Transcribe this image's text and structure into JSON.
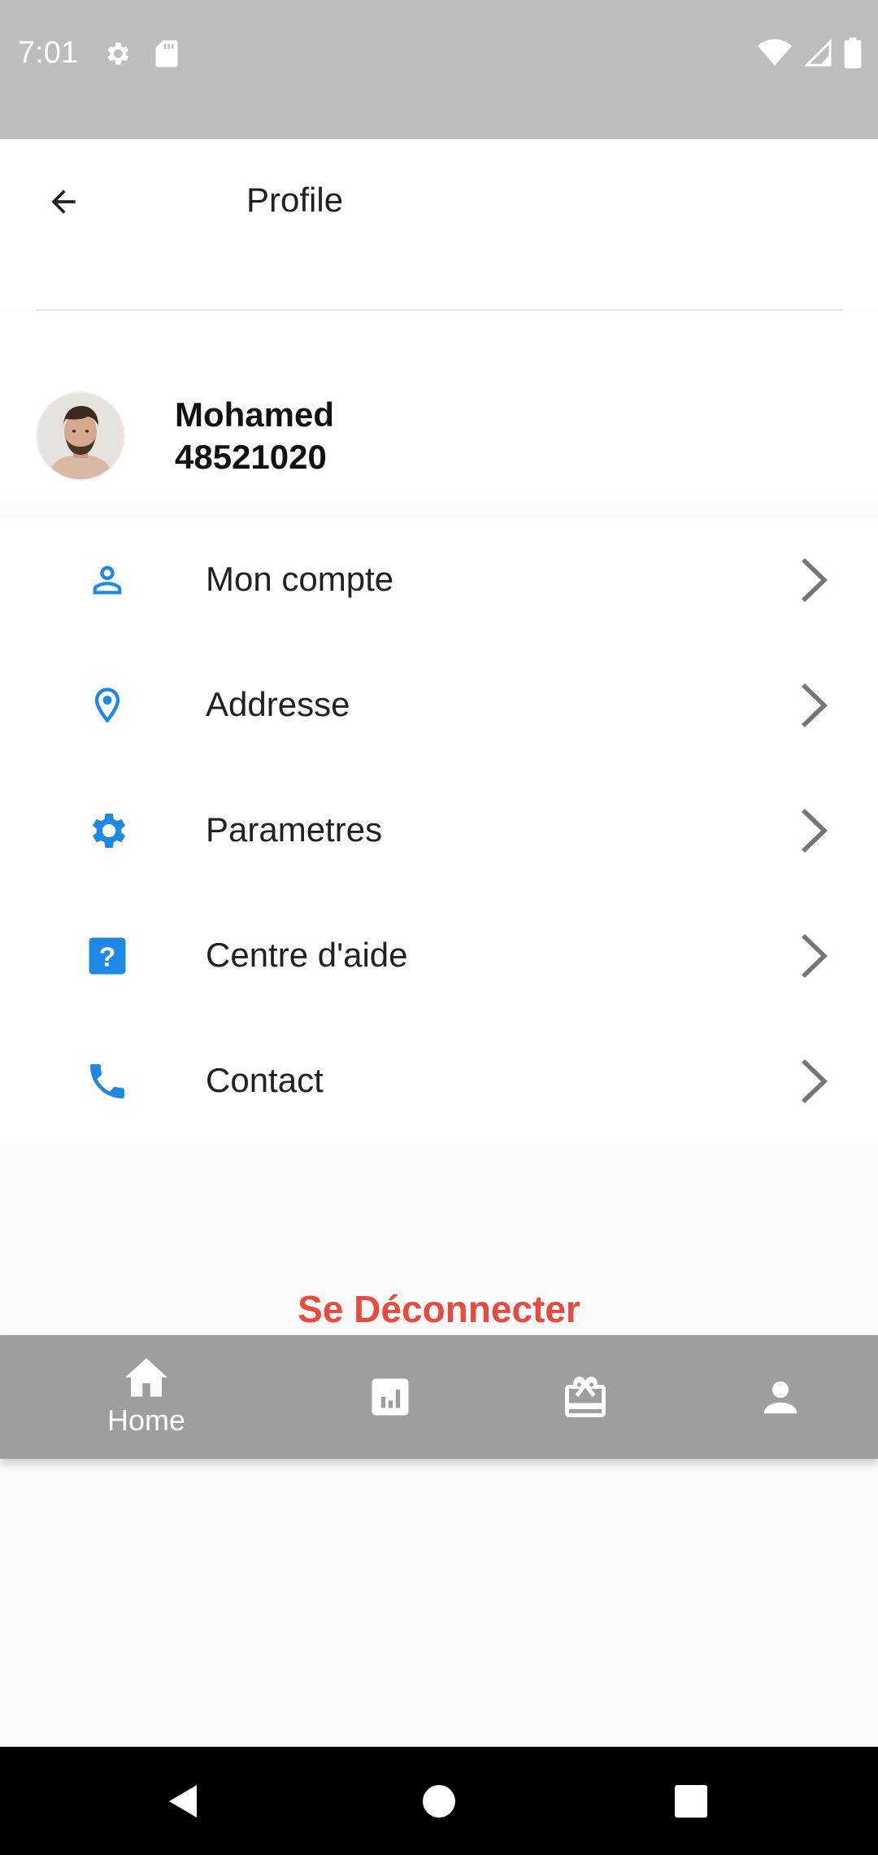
{
  "status_bar": {
    "time": "7:01",
    "icons": [
      "settings-icon",
      "sd-card-icon",
      "wifi-icon",
      "signal-icon",
      "battery-icon"
    ]
  },
  "app_bar": {
    "title": "Profile",
    "back_icon": "arrow-back-icon"
  },
  "profile": {
    "name": "Mohamed",
    "number": "48521020"
  },
  "menu": {
    "items": [
      {
        "label": "Mon compte",
        "icon": "person-icon"
      },
      {
        "label": "Addresse",
        "icon": "location-pin-icon"
      },
      {
        "label": "Parametres",
        "icon": "gear-icon"
      },
      {
        "label": "Centre d'aide",
        "icon": "help-icon"
      },
      {
        "label": "Contact",
        "icon": "phone-icon"
      }
    ]
  },
  "logout_label": "Se Déconnecter",
  "bottom_nav": {
    "items": [
      {
        "label": "Home",
        "icon": "home-icon"
      },
      {
        "label": "",
        "icon": "stats-icon"
      },
      {
        "label": "",
        "icon": "gift-card-icon"
      },
      {
        "label": "",
        "icon": "profile-icon"
      }
    ]
  },
  "colors": {
    "accent": "#1e88e5",
    "logout": "#e84a3d",
    "status_bar": "#bdbdbd",
    "bottom_nav": "#9e9e9e"
  }
}
